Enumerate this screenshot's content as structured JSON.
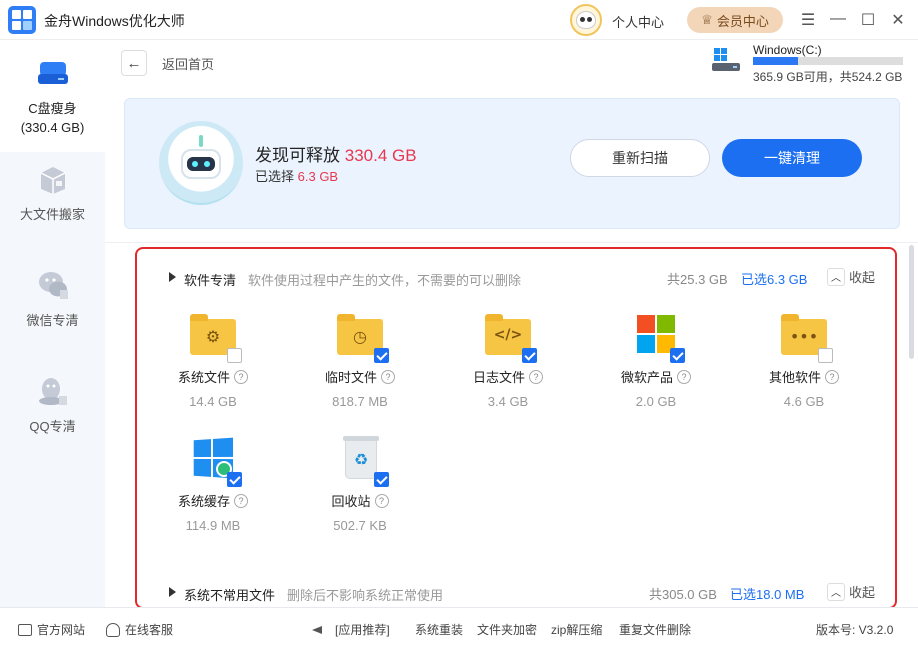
{
  "app": {
    "title": "金舟Windows优化大师",
    "user_center": "个人中心",
    "vip": "会员中心",
    "vip_icon": "crown-icon",
    "controls": [
      "☰",
      "—",
      "☐",
      "✕"
    ]
  },
  "sidebar": {
    "items": [
      {
        "label_line1": "C盘瘦身",
        "label_line2": "(330.4 GB)",
        "icon": "disk-icon",
        "active": true
      },
      {
        "label_line1": "大文件搬家",
        "icon": "box-icon"
      },
      {
        "label_line1": "微信专清",
        "icon": "wechat-icon"
      },
      {
        "label_line1": "QQ专清",
        "icon": "qq-icon"
      }
    ]
  },
  "header": {
    "back_label": "返回首页",
    "disk": {
      "name": "Windows(C:)",
      "used_fraction": 0.3,
      "free": "365.9 GB可用",
      "total": "共524.2 GB"
    }
  },
  "summary": {
    "found_prefix": "发现可释放",
    "found_value": "330.4 GB",
    "selected_prefix": "已选择",
    "selected_value": "6.3 GB",
    "rescan": "重新扫描",
    "clean": "一键清理"
  },
  "sections": [
    {
      "title": "软件专清",
      "desc": "软件使用过程中产生的文件，不需要的可以删除",
      "total": "共25.3 GB",
      "selected": "已选6.3 GB",
      "collapse": "收起",
      "items": [
        {
          "name": "系统文件",
          "size": "14.4 GB",
          "checked": false,
          "icon": "gear-folder-icon"
        },
        {
          "name": "临时文件",
          "size": "818.7 MB",
          "checked": true,
          "icon": "clock-folder-icon"
        },
        {
          "name": "日志文件",
          "size": "3.4 GB",
          "checked": true,
          "icon": "code-folder-icon"
        },
        {
          "name": "微软产品",
          "size": "2.0 GB",
          "checked": true,
          "icon": "microsoft-icon"
        },
        {
          "name": "其他软件",
          "size": "4.6 GB",
          "checked": false,
          "icon": "dots-folder-icon"
        },
        {
          "name": "系统缓存",
          "size": "114.9 MB",
          "checked": true,
          "icon": "windows-icon"
        },
        {
          "name": "回收站",
          "size": "502.7 KB",
          "checked": true,
          "icon": "recycle-bin-icon"
        }
      ]
    },
    {
      "title": "系统不常用文件",
      "desc": "删除后不影响系统正常使用",
      "total": "共305.0 GB",
      "selected": "已选18.0 MB",
      "collapse": "收起"
    }
  ],
  "footer": {
    "website": "官方网站",
    "support": "在线客服",
    "recommend": "[应用推荐]",
    "links": [
      "系统重装",
      "文件夹加密",
      "zip解压缩",
      "重复文件删除"
    ],
    "version": "版本号: V3.2.0"
  }
}
